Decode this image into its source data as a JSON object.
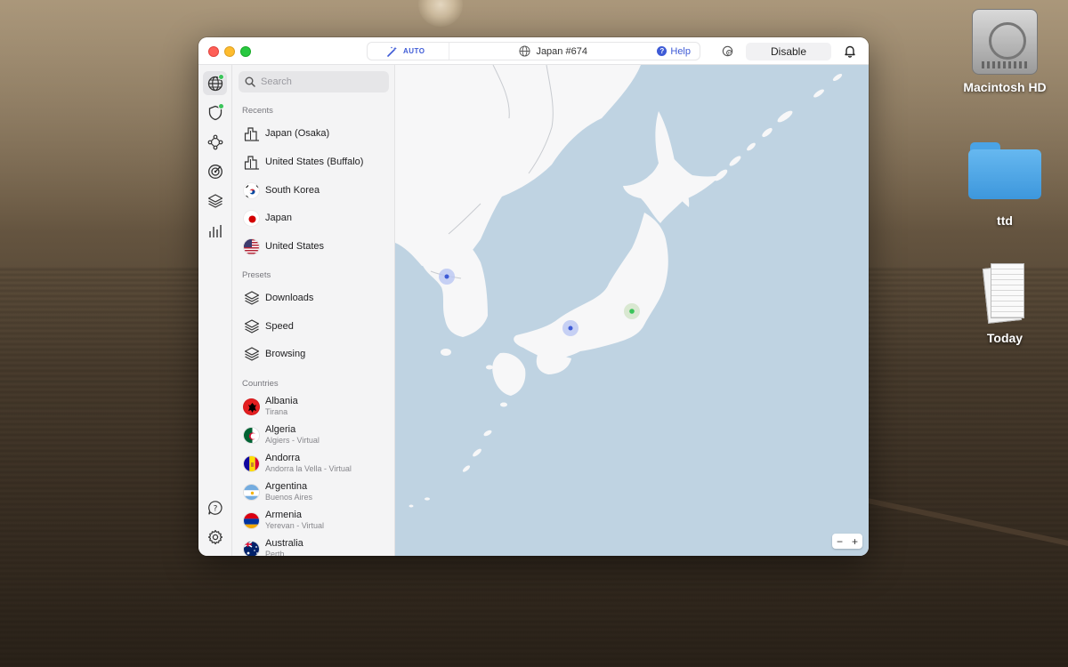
{
  "desktop": {
    "items": [
      {
        "label": "Macintosh HD",
        "icon": "hard-drive-icon"
      },
      {
        "label": "ttd",
        "icon": "folder-icon"
      },
      {
        "label": "Today",
        "icon": "document-stack-icon"
      }
    ]
  },
  "window": {
    "status": {
      "mode_label": "AUTO",
      "server": "Japan #674",
      "help_label": "Help"
    },
    "disable_label": "Disable"
  },
  "rail": {
    "items": [
      "globe-icon",
      "shield-icon",
      "meshnet-icon",
      "target-icon",
      "layers-icon",
      "stats-icon"
    ],
    "bottom": [
      "help-chat-icon",
      "settings-gear-icon"
    ]
  },
  "sidebar": {
    "search_placeholder": "Search",
    "recents_header": "Recents",
    "recents": [
      {
        "label": "Japan (Osaka)",
        "icon": "city-icon"
      },
      {
        "label": "United States (Buffalo)",
        "icon": "city-icon"
      },
      {
        "label": "South Korea",
        "icon": "flag-south-korea"
      },
      {
        "label": "Japan",
        "icon": "flag-japan"
      },
      {
        "label": "United States",
        "icon": "flag-united-states"
      }
    ],
    "presets_header": "Presets",
    "presets": [
      {
        "label": "Downloads"
      },
      {
        "label": "Speed"
      },
      {
        "label": "Browsing"
      }
    ],
    "countries_header": "Countries",
    "countries": [
      {
        "name": "Albania",
        "sub": "Tirana"
      },
      {
        "name": "Algeria",
        "sub": "Algiers - Virtual"
      },
      {
        "name": "Andorra",
        "sub": "Andorra la Vella - Virtual"
      },
      {
        "name": "Argentina",
        "sub": "Buenos Aires"
      },
      {
        "name": "Armenia",
        "sub": "Yerevan - Virtual"
      },
      {
        "name": "Australia",
        "sub": "Perth"
      }
    ]
  },
  "map": {
    "zoom_out": "−",
    "zoom_in": "+"
  },
  "colors": {
    "accent": "#3e5bd6",
    "connected": "#3ac45a",
    "map_water": "#bfd3e2",
    "map_land": "#f7f7f8"
  }
}
